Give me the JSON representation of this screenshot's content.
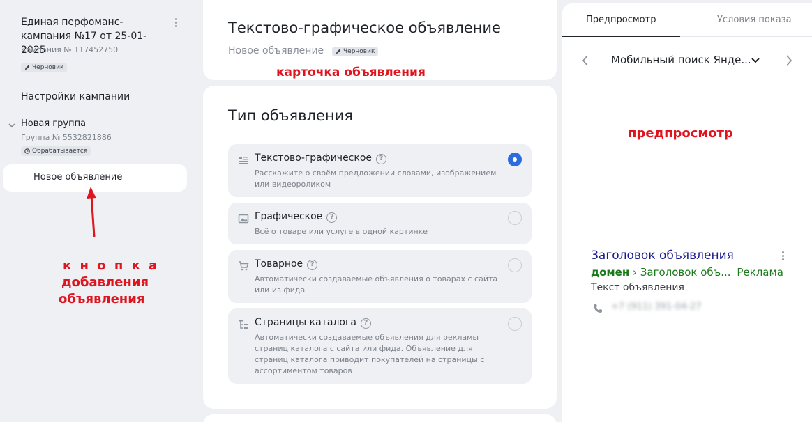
{
  "sidebar": {
    "campaign_title": "Единая перфоманс-кампания №17 от 25-01-2025",
    "campaign_id": "Кампания № 117452750",
    "campaign_badge": "Черновик",
    "settings_label": "Настройки кампании",
    "group_title": "Новая группа",
    "group_id": "Группа № 5532821886",
    "group_badge": "Обрабатывается",
    "new_ad_label": "Новое объявление"
  },
  "annotations": {
    "add_button": [
      "к н о п к а",
      "добавления",
      "объявления"
    ],
    "ad_card": "карточка объявления",
    "preview": "предпросмотр"
  },
  "header_card": {
    "title": "Текстово-графическое объявление",
    "subtitle": "Новое объявление",
    "badge": "Черновик"
  },
  "ad_type": {
    "title": "Тип объявления",
    "selected": 0,
    "options": [
      {
        "label": "Текстово-графическое",
        "description": "Расскажите о своём предложении словами, изображением или видеороликом",
        "icon": "text-graphic-icon"
      },
      {
        "label": "Графическое",
        "description": "Всё о товаре или услуге в одной картинке",
        "icon": "image-icon"
      },
      {
        "label": "Товарное",
        "description": "Автоматически создаваемые объявления о товарах с сайта или из фида",
        "icon": "cart-icon"
      },
      {
        "label": "Страницы каталога",
        "description": "Автоматически создаваемые объявления для рекламы страниц каталога с сайта или фида. Объявление для страниц каталога приводит покупателей на страницы с ассортиментом товаров",
        "icon": "catalog-tree-icon"
      }
    ]
  },
  "preview": {
    "tabs": [
      "Предпросмотр",
      "Условия показа"
    ],
    "active_tab": 0,
    "device": "Мобильный поиск Янде...",
    "snippet": {
      "title": "Заголовок объявления",
      "domain": "домен",
      "path": "› Заголовок объ...",
      "ad_label": "Реклама",
      "text": "Текст объявления",
      "phone": "+7 (911) 391-04-27"
    }
  },
  "colors": {
    "accent": "#2c6ce0",
    "annotation": "#e0141f",
    "link": "#1a1a8c",
    "url_green": "#1a7a1a"
  }
}
